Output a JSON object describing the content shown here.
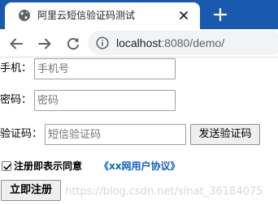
{
  "browser": {
    "tab_title": "阿里云短信验证码测试",
    "url_host": "localhost",
    "url_rest": ":8080/demo/",
    "accent": "#1a5aae"
  },
  "form": {
    "phone_label": "手机：",
    "phone_placeholder": "手机号",
    "password_label": "密码：",
    "password_placeholder": "密码",
    "code_label": "验证码：",
    "code_placeholder": "短信验证码",
    "send_code_button": "发送验证码",
    "agree_checked": true,
    "agree_text": "注册即表示同意",
    "agreement_link": "《xx网用户协议》",
    "register_button": "立即注册"
  },
  "watermark": "https://blog.csdn.net/sinat_36184075"
}
